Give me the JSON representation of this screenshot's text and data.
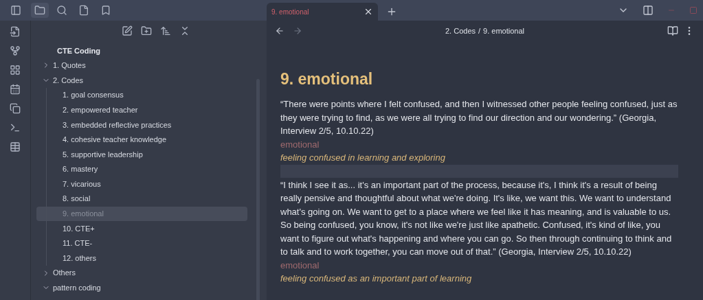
{
  "sidebar_tabs": [
    {
      "kind": "files",
      "selected": true
    },
    {
      "kind": "search",
      "selected": false
    },
    {
      "kind": "page",
      "selected": false
    },
    {
      "kind": "bookmark",
      "selected": false
    }
  ],
  "file_tree": {
    "root": "CTE Coding",
    "items": [
      {
        "label": "1. Quotes",
        "expanded": false,
        "selected": false
      },
      {
        "label": "2. Codes",
        "expanded": true,
        "selected": false,
        "children": [
          {
            "label": "1. goal consensus",
            "selected": false
          },
          {
            "label": "2. empowered teacher",
            "selected": false
          },
          {
            "label": "3. embedded reflective practices",
            "selected": false
          },
          {
            "label": "4. cohesive teacher knowledge",
            "selected": false
          },
          {
            "label": "5. supportive leadership",
            "selected": false
          },
          {
            "label": "6. mastery",
            "selected": false
          },
          {
            "label": "7. vicarious",
            "selected": false
          },
          {
            "label": "8. social",
            "selected": false
          },
          {
            "label": "9. emotional",
            "selected": true
          },
          {
            "label": "10. CTE+",
            "selected": false
          },
          {
            "label": "11. CTE-",
            "selected": false
          },
          {
            "label": "12. others",
            "selected": false
          }
        ]
      },
      {
        "label": "Others",
        "expanded": false,
        "selected": false
      },
      {
        "label": "pattern coding",
        "expanded": true,
        "selected": false
      }
    ]
  },
  "tabs": [
    {
      "label": "9. emotional",
      "selected": true
    }
  ],
  "breadcrumb": {
    "parent": "2. Codes",
    "separator": "/",
    "current": "9. emotional"
  },
  "note": {
    "title": "9. emotional",
    "blocks": [
      {
        "kind": "quote",
        "text": "“There were points where I felt confused, and then I witnessed other people feeling confused, just as they were trying to find, as we were all trying to find our  direction and our wondering.” (Georgia, Interview 2/5, 10.10.22)"
      },
      {
        "kind": "tag",
        "text": "emotional"
      },
      {
        "kind": "summary",
        "text": "feeling confused in learning and exploring"
      },
      {
        "kind": "active_line"
      },
      {
        "kind": "quote",
        "text": "“I think I see it as... it's an important part of the process, because it's, I think it's a result of being really pensive and thoughtful about what we're doing. It's like, we want this. We want to understand what's going on. We want to get to a place where we feel like it has meaning, and is valuable to us.  So being confused, you know, it's not like we're just like apathetic. Confused, it's kind of like, you want to figure out what's happening and where you can go. So then through continuing to think and to talk and to work together, you can move out of that.” (Georgia, Interview 2/5, 10.10.22)"
      },
      {
        "kind": "tag",
        "text": "emotional"
      },
      {
        "kind": "summary",
        "text": "feeling confused as an important part of learning"
      }
    ]
  }
}
